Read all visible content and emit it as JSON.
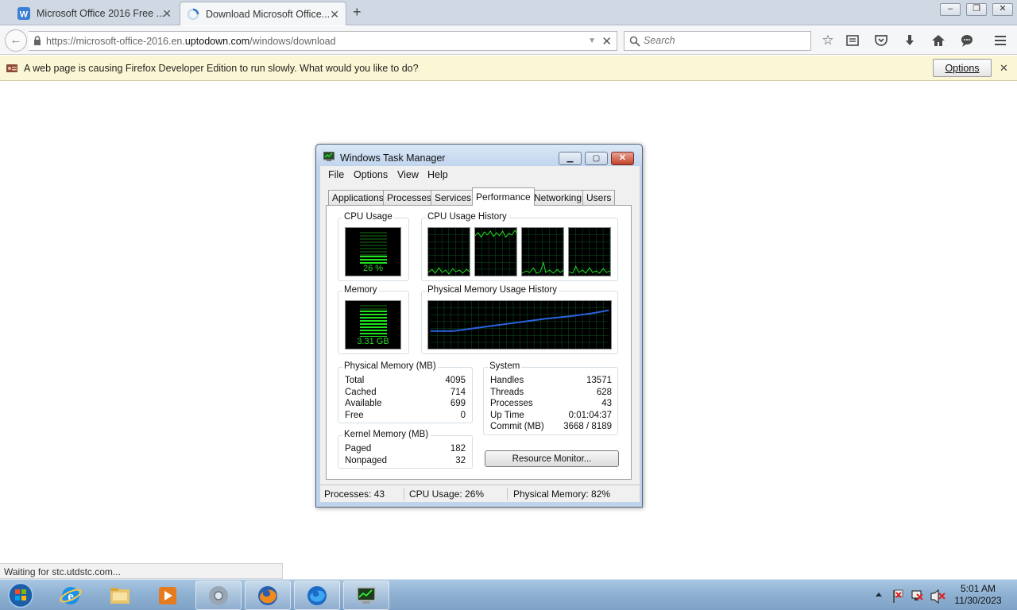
{
  "browser": {
    "tabs": [
      {
        "title": "Microsoft Office 2016 Free ...",
        "active": false
      },
      {
        "title": "Download Microsoft Office...",
        "active": true
      }
    ],
    "url": {
      "prefix": "https://microsoft-office-2016.en.",
      "domain": "uptodown.com",
      "path": "/windows/download"
    },
    "search_placeholder": "Search",
    "toolbar_icons": [
      "bookmark-star-icon",
      "reading-list-icon",
      "pocket-icon",
      "download-icon",
      "home-icon",
      "chat-icon",
      "menu-icon"
    ],
    "notification": {
      "text": "A web page is causing Firefox Developer Edition to run slowly. What would you like to do?",
      "button": "Options"
    },
    "status_text": "Waiting for stc.utdstc.com..."
  },
  "task_manager": {
    "title": "Windows Task Manager",
    "menu": [
      "File",
      "Options",
      "View",
      "Help"
    ],
    "tabs": [
      "Applications",
      "Processes",
      "Services",
      "Performance",
      "Networking",
      "Users"
    ],
    "active_tab": "Performance",
    "cpu_usage": {
      "label": "CPU Usage",
      "value_text": "26 %",
      "percent": 26
    },
    "cpu_history_label": "CPU Usage History",
    "memory": {
      "label": "Memory",
      "value_text": "3.31 GB",
      "percent": 82
    },
    "memory_history_label": "Physical Memory Usage History",
    "physical_memory": {
      "label": "Physical Memory (MB)",
      "rows": [
        {
          "k": "Total",
          "v": "4095"
        },
        {
          "k": "Cached",
          "v": "714"
        },
        {
          "k": "Available",
          "v": "699"
        },
        {
          "k": "Free",
          "v": "0"
        }
      ]
    },
    "kernel_memory": {
      "label": "Kernel Memory (MB)",
      "rows": [
        {
          "k": "Paged",
          "v": "182"
        },
        {
          "k": "Nonpaged",
          "v": "32"
        }
      ]
    },
    "system": {
      "label": "System",
      "rows": [
        {
          "k": "Handles",
          "v": "13571"
        },
        {
          "k": "Threads",
          "v": "628"
        },
        {
          "k": "Processes",
          "v": "43"
        },
        {
          "k": "Up Time",
          "v": "0:01:04:37"
        },
        {
          "k": "Commit (MB)",
          "v": "3668 / 8189"
        }
      ]
    },
    "resource_monitor_button": "Resource Monitor...",
    "status": {
      "processes": "Processes: 43",
      "cpu": "CPU Usage: 26%",
      "memory": "Physical Memory: 82%"
    }
  },
  "taskbar": {
    "apps": [
      "internet-explorer-icon",
      "file-explorer-icon",
      "media-player-icon",
      "chrome-icon",
      "firefox-icon",
      "firefox-developer-icon",
      "task-manager-icon"
    ],
    "clock_time": "5:01 AM",
    "clock_date": "11/30/2023"
  },
  "colors": {
    "graph_green": "#1ee21e",
    "memory_line": "#2b63e0",
    "notification_bg": "#fbf7d4"
  }
}
